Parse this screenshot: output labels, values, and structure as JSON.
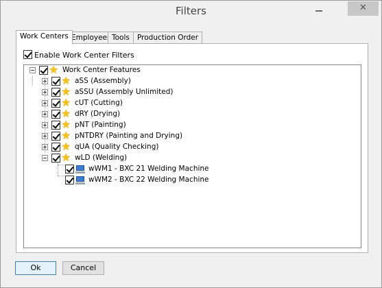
{
  "window": {
    "title": "Filters"
  },
  "titlebar": {
    "minimize_glyph": "",
    "close_glyph": "✕"
  },
  "tabs": [
    {
      "label": "Work Centers",
      "active": true
    },
    {
      "label": "Employees",
      "active": false
    },
    {
      "label": "Tools",
      "active": false
    },
    {
      "label": "Production Order",
      "active": false
    }
  ],
  "filters": {
    "enable_label": "Enable Work Center Filters",
    "enabled": true
  },
  "tree": {
    "root": {
      "label": "Work Center Features",
      "icon": "star-icon",
      "checked": true,
      "expanded": true
    },
    "items": [
      {
        "label": "aSS (Assembly)",
        "icon": "star-icon",
        "checked": true,
        "expanded": false
      },
      {
        "label": "aSSU (Assembly Unlimited)",
        "icon": "star-icon",
        "checked": true,
        "expanded": false
      },
      {
        "label": "cUT (Cutting)",
        "icon": "star-icon",
        "checked": true,
        "expanded": false
      },
      {
        "label": "dRY (Drying)",
        "icon": "star-icon",
        "checked": true,
        "expanded": false
      },
      {
        "label": "pNT (Painting)",
        "icon": "star-icon",
        "checked": true,
        "expanded": false
      },
      {
        "label": "pNTDRY (Painting and Drying)",
        "icon": "star-icon",
        "checked": true,
        "expanded": false
      },
      {
        "label": "qUA (Quality Checking)",
        "icon": "star-icon",
        "checked": true,
        "expanded": false
      },
      {
        "label": "wLD (Welding)",
        "icon": "star-icon",
        "checked": true,
        "expanded": true
      }
    ],
    "children": [
      {
        "label": "wWM1 - BXC 21 Welding Machine",
        "icon": "machine-icon",
        "checked": true
      },
      {
        "label": "wWM2 - BXC 22 Welding Machine",
        "icon": "machine-icon",
        "checked": true
      }
    ]
  },
  "buttons": {
    "ok_label": "Ok",
    "cancel_label": "Cancel"
  },
  "colors": {
    "star": "#f2c21b",
    "machine": "#3c7fd1",
    "default_button_border": "#3c7fb1"
  }
}
